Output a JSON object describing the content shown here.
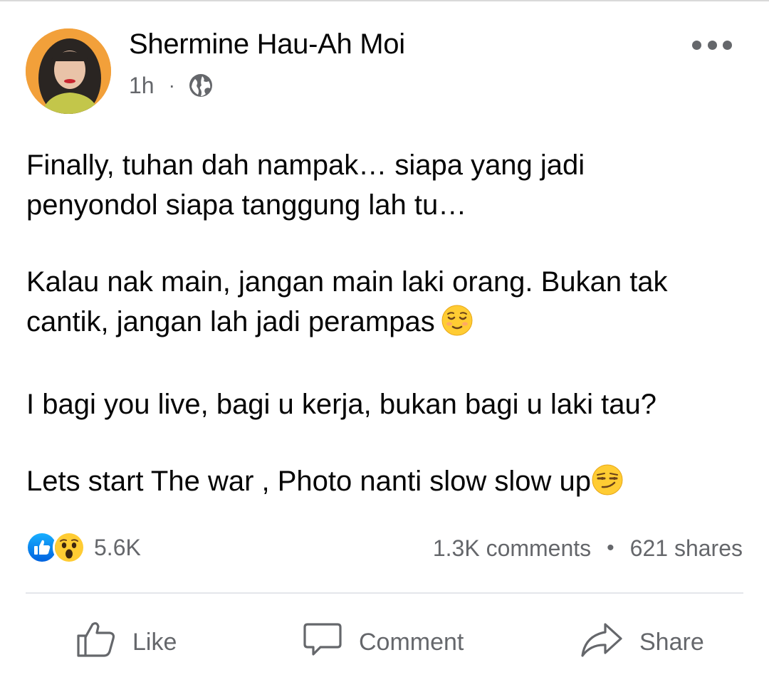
{
  "post": {
    "author": "Shermine Hau-Ah Moi",
    "time": "1h",
    "separator": "·",
    "audience_icon": "globe-icon",
    "more_icon": "more-options-icon",
    "paragraphs": [
      {
        "text": "Finally, tuhan dah nampak… siapa yang jadi\npenyondol siapa tanggung lah tu…",
        "emoji": ""
      },
      {
        "text": "Kalau nak main, jangan main laki orang. Bukan tak\ncantik, jangan lah jadi perampas",
        "emoji": "relieved-face"
      },
      {
        "text": "I bagi you live, bagi u kerja, bukan bagi u laki tau?",
        "emoji": ""
      },
      {
        "text": "Lets start The war , Photo nanti slow slow up",
        "emoji": "smirking-face"
      }
    ]
  },
  "engagement": {
    "reactions": [
      "like-reaction-icon",
      "wow-reaction-icon"
    ],
    "reaction_count": "5.6K",
    "comments": "1.3K comments",
    "count_separator": "•",
    "shares": "621 shares"
  },
  "actions": {
    "like_label": "Like",
    "comment_label": "Comment",
    "share_label": "Share"
  },
  "colors": {
    "text_primary": "#050505",
    "text_secondary": "#65676b",
    "like_blue": "#1877f2",
    "emoji_yellow": "#ffcc33",
    "divider": "#e4e6eb"
  }
}
